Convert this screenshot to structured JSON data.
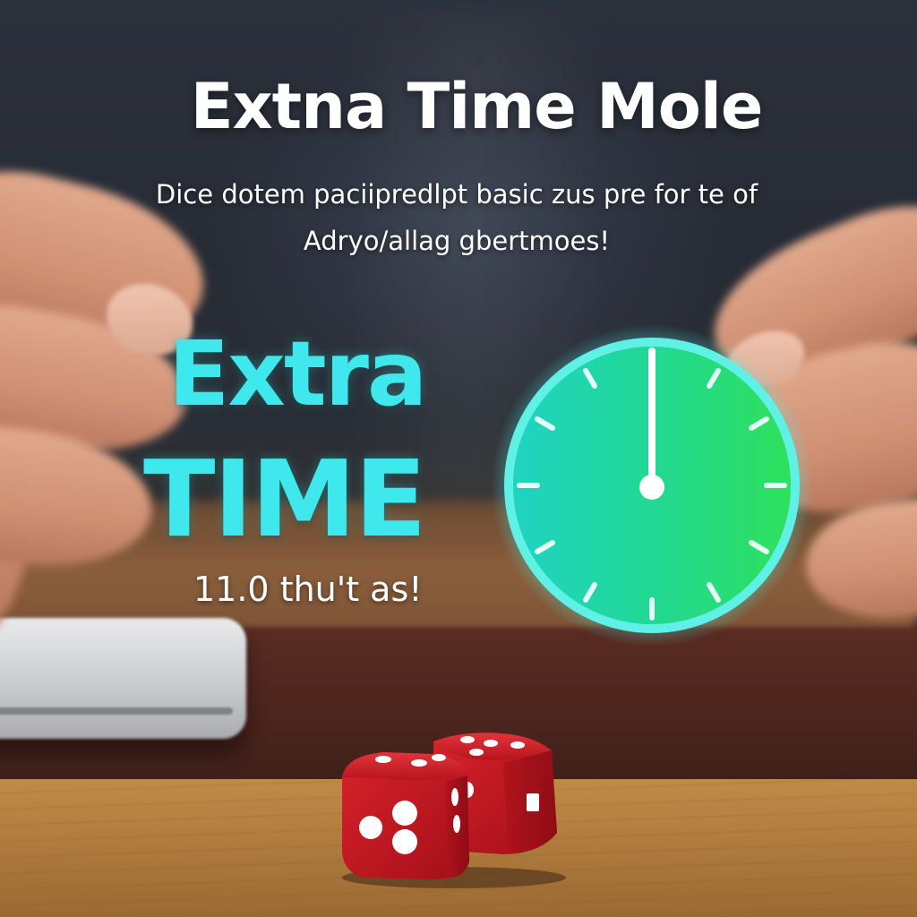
{
  "headline": "Extna Time Mole",
  "subtitle": {
    "line1": "Dice dotem paciipredlpt basic zus pre for te of",
    "line2": "Adryo/allag gbertmoes!"
  },
  "hero": {
    "word1": "Extra",
    "word2": "TIME",
    "caption": "11.0 thu't as!"
  },
  "colors": {
    "accent": "#3fe8ec",
    "clock_green": "#2fe06a",
    "dice_red": "#cc1c26",
    "text": "#ffffff"
  },
  "icons": {
    "clock": "clock-icon",
    "dice": "dice-icon"
  }
}
